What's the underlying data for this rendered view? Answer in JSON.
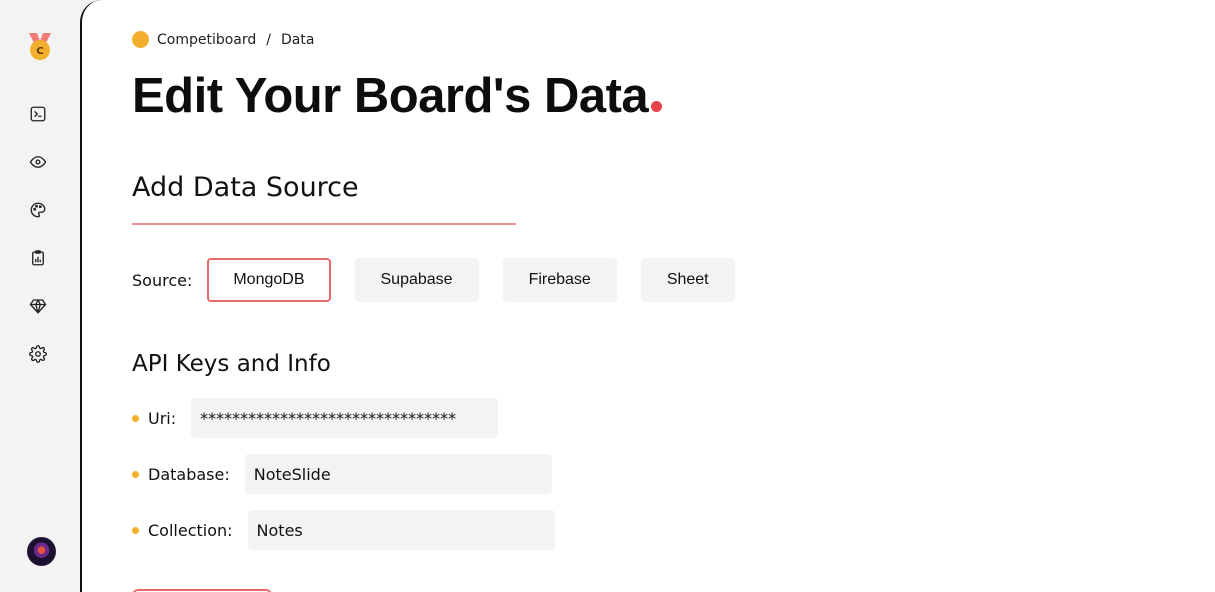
{
  "sidebar": {
    "logo_letter": "C",
    "items": [
      {
        "icon": "terminal-icon"
      },
      {
        "icon": "eye-icon"
      },
      {
        "icon": "palette-icon"
      },
      {
        "icon": "clipboard-chart-icon"
      },
      {
        "icon": "diamond-icon"
      },
      {
        "icon": "gear-icon"
      }
    ]
  },
  "breadcrumb": {
    "root": "Competiboard",
    "separator": "/",
    "current": "Data"
  },
  "page": {
    "title": "Edit Your Board's Data"
  },
  "data_source": {
    "section_title": "Add Data Source",
    "label": "Source:",
    "options": [
      "MongoDB",
      "Supabase",
      "Firebase",
      "Sheet"
    ],
    "selected": "MongoDB"
  },
  "api": {
    "section_title": "API Keys and Info",
    "fields": [
      {
        "label": "Uri:",
        "value": "********************************"
      },
      {
        "label": "Database:",
        "value": "NoteSlide"
      },
      {
        "label": "Collection:",
        "value": "Notes"
      }
    ]
  },
  "colors": {
    "accent_red": "#e8434b",
    "accent_orange": "#f4ae2e",
    "active_border": "#e86a6a"
  }
}
